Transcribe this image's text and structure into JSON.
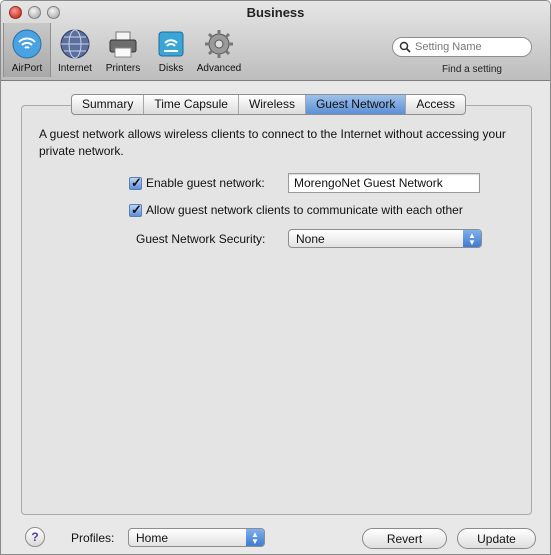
{
  "window": {
    "title": "Business"
  },
  "toolbar": {
    "items": [
      {
        "label": "AirPort",
        "icon": "airport-icon",
        "selected": true
      },
      {
        "label": "Internet",
        "icon": "internet-icon"
      },
      {
        "label": "Printers",
        "icon": "printer-icon"
      },
      {
        "label": "Disks",
        "icon": "disk-icon"
      },
      {
        "label": "Advanced",
        "icon": "gear-icon"
      }
    ],
    "search_placeholder": "Setting Name",
    "find_label": "Find a setting"
  },
  "tabs": [
    {
      "label": "Summary"
    },
    {
      "label": "Time Capsule"
    },
    {
      "label": "Wireless"
    },
    {
      "label": "Guest Network",
      "active": true
    },
    {
      "label": "Access"
    }
  ],
  "content": {
    "description": "A guest network allows wireless clients to connect to the Internet without accessing your private network.",
    "enable_label": "Enable guest network:",
    "enable_checked": true,
    "guest_name": "MorengoNet Guest Network",
    "allow_label": "Allow guest network clients to communicate with each other",
    "allow_checked": true,
    "security_label": "Guest Network Security:",
    "security_value": "None"
  },
  "footer": {
    "help": "?",
    "profiles_label": "Profiles:",
    "profile_value": "Home",
    "revert_label": "Revert",
    "update_label": "Update"
  },
  "colors": {
    "accent": "#5b8fd6",
    "close": "#d23a2f"
  }
}
